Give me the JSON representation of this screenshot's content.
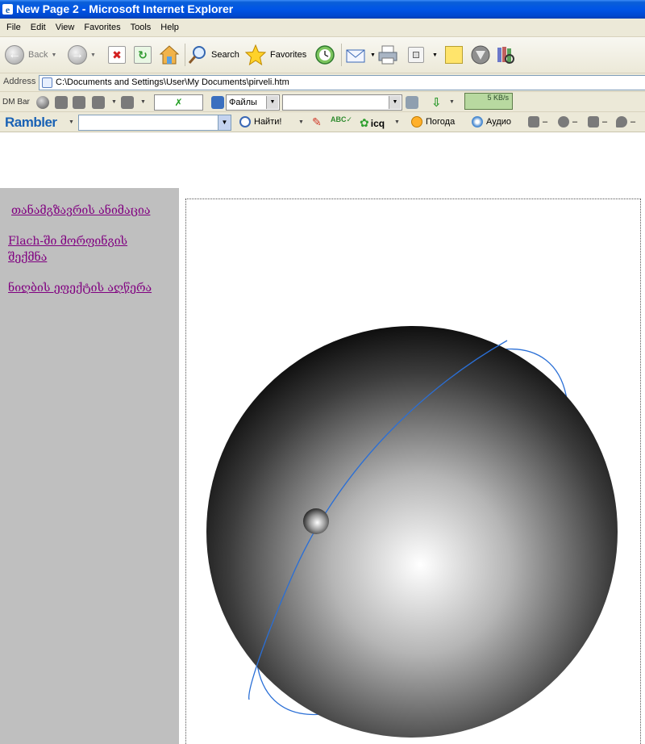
{
  "window": {
    "title": "New Page 2 - Microsoft Internet Explorer"
  },
  "menu": [
    "File",
    "Edit",
    "View",
    "Favorites",
    "Tools",
    "Help"
  ],
  "toolbar": {
    "back_label": "Back",
    "search_label": "Search",
    "favorites_label": "Favorites"
  },
  "address": {
    "label": "Address",
    "url": "C:\\Documents and Settings\\User\\My Documents\\pirveli.htm"
  },
  "dm_bar": {
    "label": "DM Bar",
    "folder_select": "Файлы",
    "speed": "5 KB/s"
  },
  "rambler": {
    "logo": "Rambler",
    "search_button": "Найти!",
    "icq_label": "icq",
    "weather_label": "Погода",
    "audio_label": "Аудио",
    "dash": "–"
  },
  "sidebar": {
    "links": [
      "თანამგზავრის ანიმაცია",
      "Flach-ში მორფინგის შექმნა",
      "ნიღბის ეფექტის აღწერა"
    ]
  },
  "colors": {
    "titlebar": "#0055e6",
    "chrome": "#ece9d8",
    "sidebar_bg": "#bfbfbf",
    "link": "#800080",
    "orbit": "#2a6fd6"
  }
}
